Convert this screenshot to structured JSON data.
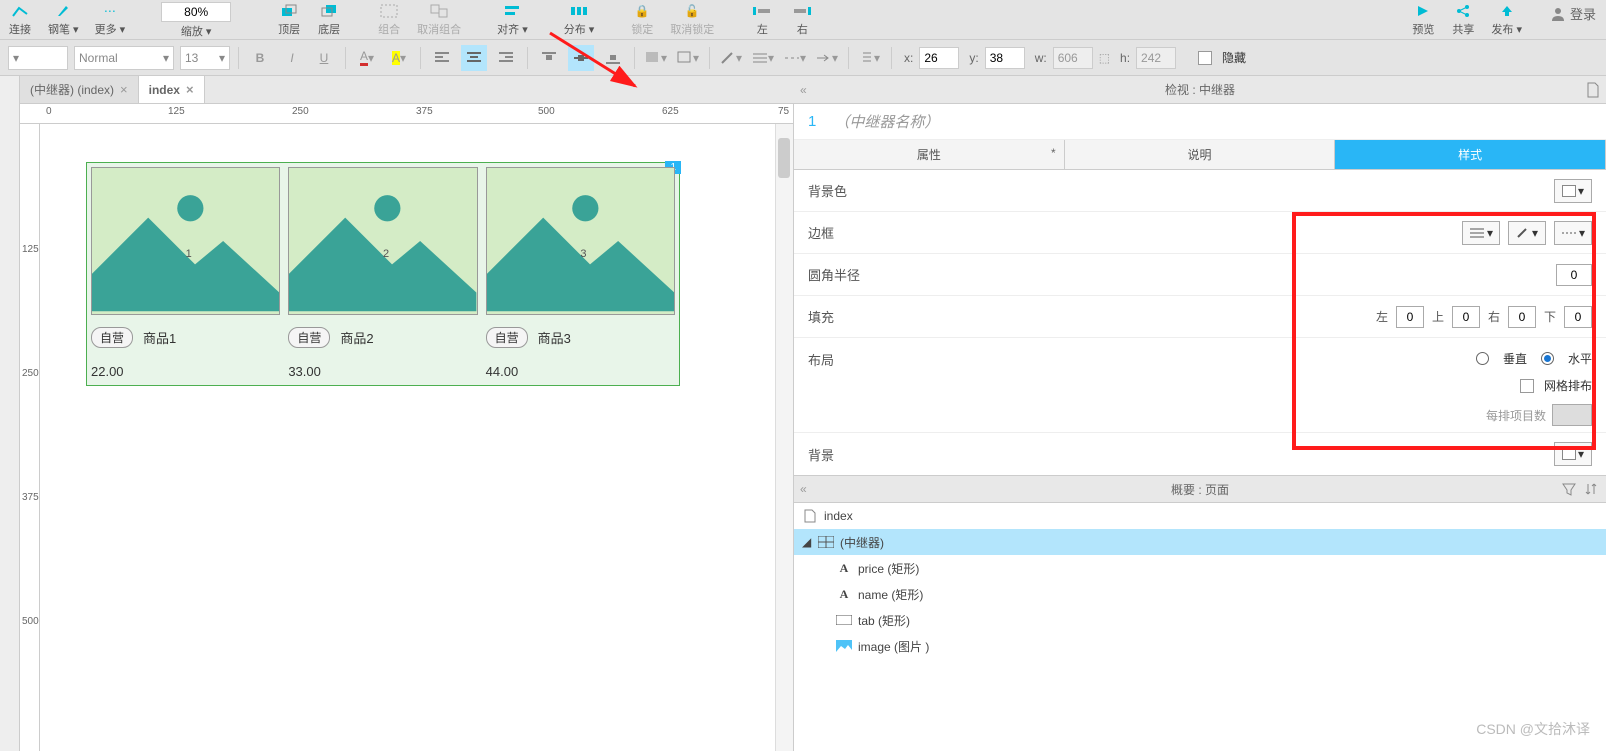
{
  "toolbar1": {
    "items": [
      {
        "label": "连接"
      },
      {
        "label": "钢笔"
      },
      {
        "label": "更多"
      },
      {
        "label": "缩放",
        "value": "80%"
      },
      {
        "label": "顶层"
      },
      {
        "label": "底层"
      },
      {
        "label": "组合"
      },
      {
        "label": "取消组合"
      },
      {
        "label": "对齐"
      },
      {
        "label": "分布"
      },
      {
        "label": "锁定"
      },
      {
        "label": "取消锁定"
      },
      {
        "label": "左"
      },
      {
        "label": "右"
      }
    ],
    "right": [
      {
        "label": "预览"
      },
      {
        "label": "共享"
      },
      {
        "label": "发布"
      }
    ],
    "login": "登录"
  },
  "toolbar2": {
    "style_dd": "Normal",
    "font_size": "13",
    "coords": {
      "x_label": "x:",
      "x": "26",
      "y_label": "y:",
      "y": "38",
      "w_label": "w:",
      "w": "606",
      "h_label": "h:",
      "h": "242"
    },
    "hidden_label": "隐藏"
  },
  "tabs": [
    {
      "label": "(中继器) (index)",
      "active": false
    },
    {
      "label": "index",
      "active": true
    }
  ],
  "ruler_h": [
    "0",
    "125",
    "250",
    "375",
    "500",
    "625",
    "75"
  ],
  "ruler_v": [
    "125",
    "250",
    "375",
    "500"
  ],
  "repeater": {
    "badge": "1",
    "items": [
      {
        "num": "1",
        "tag": "自营",
        "name": "商品1",
        "price": "22.00"
      },
      {
        "num": "2",
        "tag": "自营",
        "name": "商品2",
        "price": "33.00"
      },
      {
        "num": "3",
        "tag": "自营",
        "name": "商品3",
        "price": "44.00"
      }
    ]
  },
  "inspector": {
    "header": "检视 : 中继器",
    "num": "1",
    "name_placeholder": "（中继器名称）",
    "tabs": {
      "prop": "属性",
      "notes": "说明",
      "style": "样式",
      "req": "*"
    },
    "rows": {
      "bg": "背景色",
      "border": "边框",
      "radius": "圆角半径",
      "radius_val": "0",
      "padding": "填充",
      "pad": {
        "l": "左",
        "t": "上",
        "r": "右",
        "b": "下",
        "val": "0"
      },
      "layout": "布局",
      "vert": "垂直",
      "horz": "水平",
      "grid": "网格排布",
      "per_row": "每排项目数",
      "bg2": "背景"
    }
  },
  "outline": {
    "header": "概要 : 页面",
    "items": [
      {
        "label": "index",
        "icon": "page",
        "indent": 1
      },
      {
        "label": "(中继器)",
        "icon": "repeater",
        "indent": 1,
        "sel": true,
        "expand": true
      },
      {
        "label": "price (矩形)",
        "icon": "text",
        "indent": 2
      },
      {
        "label": "name (矩形)",
        "icon": "text",
        "indent": 2
      },
      {
        "label": "tab (矩形)",
        "icon": "rect",
        "indent": 2
      },
      {
        "label": "image (图片 )",
        "icon": "image",
        "indent": 2
      }
    ]
  },
  "watermark": "CSDN @文拾沐译"
}
